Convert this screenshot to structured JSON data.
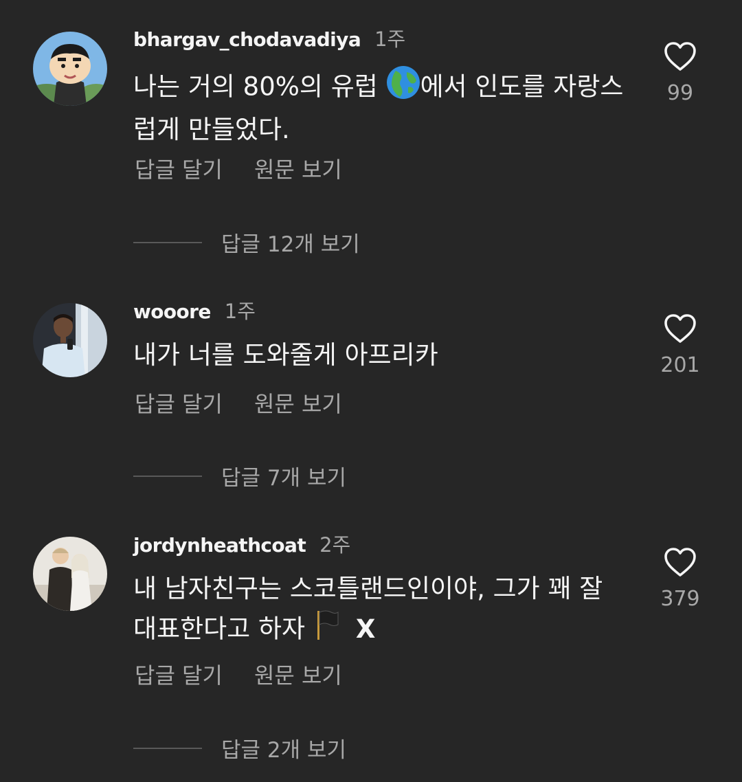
{
  "comments": [
    {
      "username": "bhargav_chodavadiya",
      "time": "1주",
      "text_before": "나는 거의 80%의 유럽 ",
      "text_after": "에서 인도를 자랑스\n럽게 만들었다.",
      "emoji": "globe-europe-africa",
      "likes": "99",
      "reply_label": "답글 달기",
      "original_label": "원문 보기",
      "view_replies": "답글 12개 보기"
    },
    {
      "username": "wooore",
      "time": "1주",
      "text": "내가 너를 도와줄게 아프리카",
      "likes": "201",
      "reply_label": "답글 달기",
      "original_label": "원문 보기",
      "view_replies": "답글 7개 보기"
    },
    {
      "username": "jordynheathcoat",
      "time": "2주",
      "text_line1": "내 남자친구는 스코틀랜드인이야, 그가 꽤 잘",
      "text_line2": "대표한다고 하자 ",
      "emoji": "black-flag",
      "extra": "X",
      "likes": "379",
      "reply_label": "답글 달기",
      "original_label": "원문 보기",
      "view_replies": "답글 2개 보기"
    }
  ],
  "colors": {
    "background": "#262626",
    "primary_text": "#f5f5f5",
    "secondary_text": "#a8a8a8",
    "divider": "#595959"
  },
  "icons": {
    "like": "heart-outline-icon"
  }
}
